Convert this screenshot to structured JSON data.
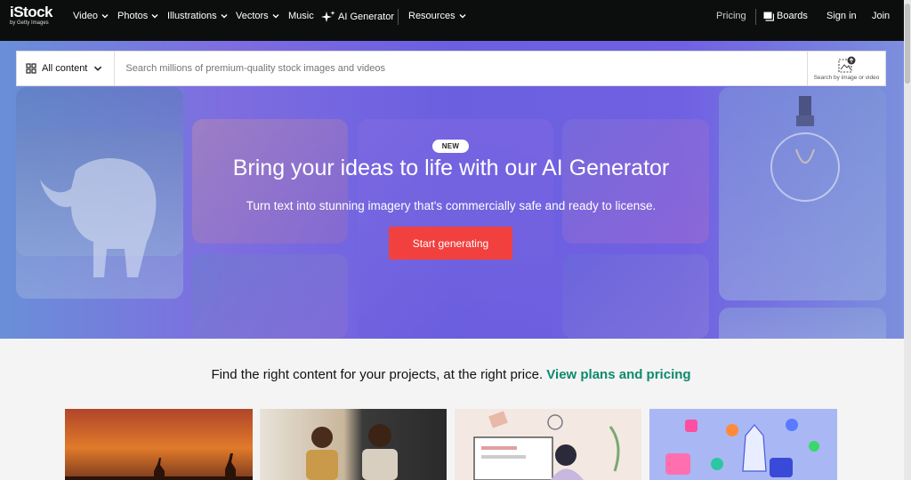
{
  "nav": {
    "logo_main": "iStock",
    "logo_sub": "by Getty Images",
    "items": [
      {
        "label": "Video",
        "dropdown": true
      },
      {
        "label": "Photos",
        "dropdown": true
      },
      {
        "label": "Illustrations",
        "dropdown": true
      },
      {
        "label": "Vectors",
        "dropdown": true
      },
      {
        "label": "Music",
        "dropdown": false
      },
      {
        "label": "AI Generator",
        "dropdown": false
      },
      {
        "label": "Resources",
        "dropdown": true
      }
    ],
    "pricing": "Pricing",
    "boards": "Boards",
    "signin": "Sign in",
    "join": "Join"
  },
  "search": {
    "filter_label": "All content",
    "placeholder": "Search millions of premium-quality stock images and videos",
    "image_search_label": "Search by image or video"
  },
  "hero": {
    "badge": "NEW",
    "title": "Bring your ideas to life with our AI Generator",
    "subtitle": "Turn text into stunning imagery that's commercially safe and ready to license.",
    "cta": "Start generating"
  },
  "promo": {
    "text": "Find the right content for your projects, at the right price.",
    "link": "View plans and pricing"
  },
  "colors": {
    "nav_bg": "#0c0d0d",
    "cta": "#f2403f",
    "link": "#0c8a6f",
    "hero_gradient": [
      "#6a8fd8",
      "#6b5fe0",
      "#7c8fdd"
    ]
  }
}
